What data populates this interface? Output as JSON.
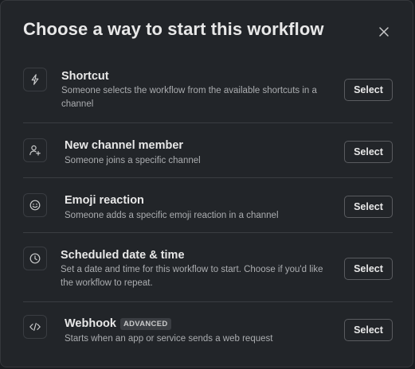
{
  "dialog": {
    "title": "Choose a way to start this workflow",
    "close_icon": "close-icon"
  },
  "options": [
    {
      "icon": "lightning-icon",
      "title": "Shortcut",
      "description": "Someone selects the workflow from the available shortcuts in a channel",
      "button": "Select"
    },
    {
      "icon": "person-add-icon",
      "title": "New channel member",
      "description": "Someone joins a specific channel",
      "button": "Select"
    },
    {
      "icon": "emoji-icon",
      "title": "Emoji reaction",
      "description": "Someone adds a specific emoji reaction in a channel",
      "button": "Select"
    },
    {
      "icon": "clock-icon",
      "title": "Scheduled date & time",
      "description": "Set a date and time for this workflow to start. Choose if you'd like the workflow to repeat.",
      "button": "Select"
    },
    {
      "icon": "code-icon",
      "title": "Webhook",
      "badge": "ADVANCED",
      "description": "Starts when an app or service sends a web request",
      "button": "Select"
    }
  ]
}
